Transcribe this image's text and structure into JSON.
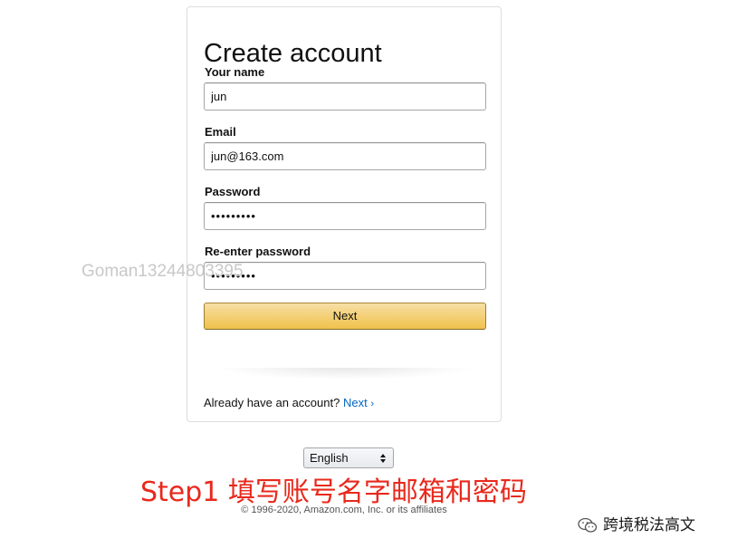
{
  "page": {
    "title": "Create account"
  },
  "form": {
    "name_label": "Your name",
    "name_value": "jun",
    "email_label": "Email",
    "email_value": "jun@163.com",
    "password_label": "Password",
    "password_value": "•••••••••",
    "reenter_label": "Re-enter password",
    "reenter_value": "•••••••••",
    "next_button": "Next"
  },
  "signin": {
    "prompt": "Already have an account?",
    "link_label": "Next",
    "chevron": "›"
  },
  "footer": {
    "language": "English",
    "language_arrows": "◆",
    "copyright": "© 1996-2020, Amazon.com, Inc. or its affiliates"
  },
  "overlay": {
    "watermark": "Goman13244803395",
    "caption": "Step1 填写账号名字邮箱和密码",
    "source_label": "跨境税法高文"
  },
  "colors": {
    "accent_link": "#0066c0",
    "button_top": "#f7dfa5",
    "button_bottom": "#f0c14b",
    "caption": "#e8291c"
  },
  "icons": {
    "wechat_mark": "wechat-logo-icon",
    "select_arrows": "updown-arrows-icon"
  }
}
